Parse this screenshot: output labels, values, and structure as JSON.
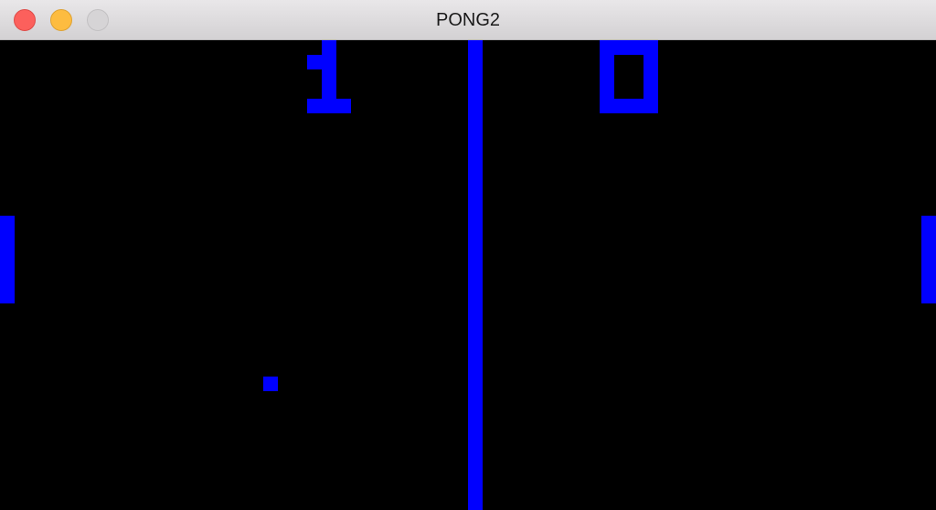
{
  "window": {
    "title": "PONG2"
  },
  "colors": {
    "court": "#000000",
    "game_blue": "#0000ff"
  },
  "game": {
    "score_left": "1",
    "score_right": "0"
  },
  "icons": [
    "close-button",
    "minimize-button",
    "zoom-button"
  ]
}
